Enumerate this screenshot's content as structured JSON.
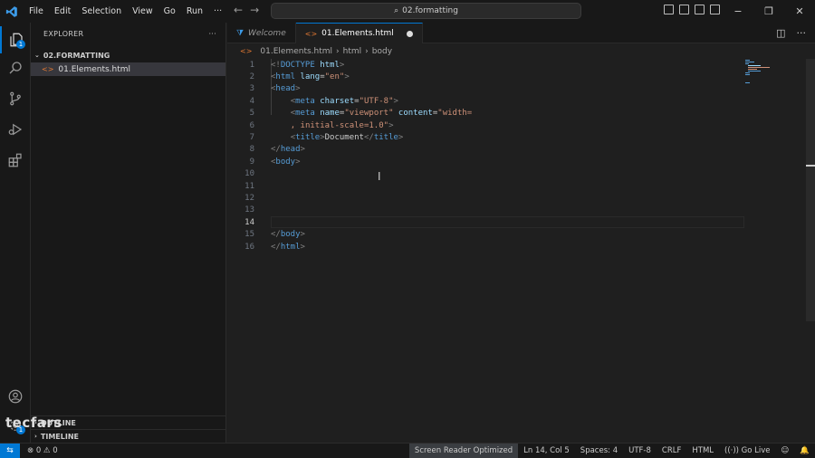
{
  "menu": [
    "File",
    "Edit",
    "Selection",
    "View",
    "Go",
    "Run",
    "···"
  ],
  "command_center": "02.formatting",
  "window_controls": {
    "minimize": "−",
    "restore": "❐",
    "close": "✕"
  },
  "sidebar": {
    "title": "EXPLORER",
    "more": "···",
    "folder": "02.FORMATTING",
    "file": "01.Elements.html",
    "outline": "OUTLINE",
    "timeline": "TIMELINE"
  },
  "activity": {
    "explorer_badge": "1",
    "accounts_badge": "1"
  },
  "tabs": [
    {
      "label": "Welcome"
    },
    {
      "label": "01.Elements.html"
    }
  ],
  "breadcrumbs": [
    "01.Elements.html",
    "html",
    "body"
  ],
  "code_lines": [
    {
      "n": "1",
      "parts": [
        [
          "tg",
          "<!"
        ],
        [
          "t",
          "DOCTYPE"
        ],
        [
          "a",
          " html"
        ],
        [
          "tg",
          ">"
        ]
      ]
    },
    {
      "n": "2",
      "parts": [
        [
          "tg",
          "<"
        ],
        [
          "t",
          "html"
        ],
        [
          "a",
          " lang"
        ],
        [
          "w",
          "="
        ],
        [
          "s",
          "\"en\""
        ],
        [
          "tg",
          ">"
        ]
      ]
    },
    {
      "n": "3",
      "parts": [
        [
          "tg",
          "<"
        ],
        [
          "t",
          "head"
        ],
        [
          "tg",
          ">"
        ]
      ]
    },
    {
      "n": "4",
      "parts": [
        [
          "w",
          "    "
        ],
        [
          "tg",
          "<"
        ],
        [
          "t",
          "meta"
        ],
        [
          "a",
          " charset"
        ],
        [
          "w",
          "="
        ],
        [
          "s",
          "\"UTF-8\""
        ],
        [
          "tg",
          ">"
        ]
      ]
    },
    {
      "n": "5",
      "parts": [
        [
          "w",
          "    "
        ],
        [
          "tg",
          "<"
        ],
        [
          "t",
          "meta"
        ],
        [
          "a",
          " name"
        ],
        [
          "w",
          "="
        ],
        [
          "s",
          "\"viewport\""
        ],
        [
          "a",
          " content"
        ],
        [
          "w",
          "="
        ],
        [
          "s",
          "\"width="
        ]
      ]
    },
    {
      "n": "6",
      "parts": [
        [
          "w",
          "    "
        ],
        [
          "s",
          ", initial-scale=1.0\""
        ],
        [
          "tg",
          ">"
        ]
      ]
    },
    {
      "n": "7",
      "parts": [
        [
          "w",
          "    "
        ],
        [
          "tg",
          "<"
        ],
        [
          "t",
          "title"
        ],
        [
          "tg",
          ">"
        ],
        [
          "w",
          "Document"
        ],
        [
          "tg",
          "</"
        ],
        [
          "t",
          "title"
        ],
        [
          "tg",
          ">"
        ]
      ]
    },
    {
      "n": "8",
      "parts": [
        [
          "tg",
          "</"
        ],
        [
          "t",
          "head"
        ],
        [
          "tg",
          ">"
        ]
      ]
    },
    {
      "n": "9",
      "parts": [
        [
          "tg",
          "<"
        ],
        [
          "t",
          "body"
        ],
        [
          "tg",
          ">"
        ]
      ]
    },
    {
      "n": "10",
      "parts": []
    },
    {
      "n": "11",
      "parts": []
    },
    {
      "n": "12",
      "parts": []
    },
    {
      "n": "13",
      "parts": []
    },
    {
      "n": "14",
      "parts": [],
      "current": true
    },
    {
      "n": "15",
      "parts": [
        [
          "tg",
          "</"
        ],
        [
          "t",
          "body"
        ],
        [
          "tg",
          ">"
        ]
      ]
    },
    {
      "n": "16",
      "parts": [
        [
          "tg",
          "</"
        ],
        [
          "t",
          "html"
        ],
        [
          "tg",
          ">"
        ]
      ]
    }
  ],
  "status": {
    "remote": "⇆",
    "problems": "⊗ 0 ⚠ 0",
    "screen_reader": "Screen Reader Optimized",
    "position": "Ln 14, Col 5",
    "spaces": "Spaces: 4",
    "encoding": "UTF-8",
    "eol": "CRLF",
    "language": "HTML",
    "golive": "((·)) Go Live",
    "feedback": "☺",
    "bell": "🔔"
  },
  "watermark": "tecfars",
  "colors": {
    "accent": "#0078d4",
    "html_icon": "#e37933",
    "tag": "#569cd6",
    "attr": "#9cdcfe",
    "string": "#ce9178"
  }
}
